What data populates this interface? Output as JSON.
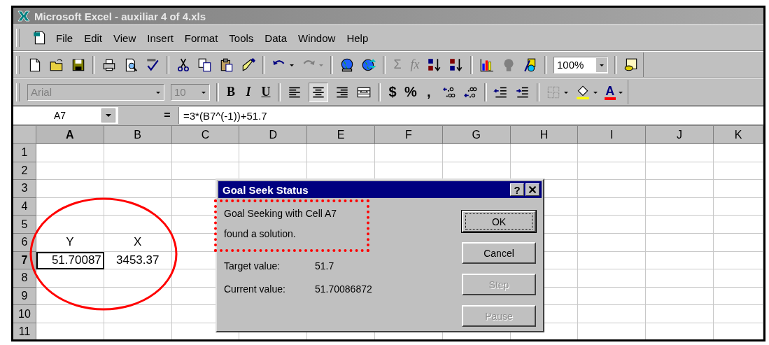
{
  "window": {
    "title": "Microsoft Excel - auxiliar 4 of 4.xls"
  },
  "menu": [
    "File",
    "Edit",
    "View",
    "Insert",
    "Format",
    "Tools",
    "Data",
    "Window",
    "Help"
  ],
  "standard_toolbar": {
    "sum": "Σ",
    "function": "fx",
    "zoom": "100%"
  },
  "formatting_toolbar": {
    "font": "Arial",
    "size": "10",
    "bold": "B",
    "italic": "I",
    "underline": "U",
    "currency": "$",
    "percent": "%",
    "comma": ",",
    "font_color": "A"
  },
  "formula_bar": {
    "name_box": "A7",
    "equals": "=",
    "formula": "=3*(B7^(-1))+51.7"
  },
  "sheet": {
    "columns": [
      {
        "label": "A",
        "selected": true
      },
      {
        "label": "B",
        "selected": false
      },
      {
        "label": "C",
        "selected": false
      },
      {
        "label": "D",
        "selected": false
      },
      {
        "label": "E",
        "selected": false
      },
      {
        "label": "F",
        "selected": false
      },
      {
        "label": "G",
        "selected": false
      },
      {
        "label": "H",
        "selected": false
      },
      {
        "label": "I",
        "selected": false
      },
      {
        "label": "J",
        "selected": false
      },
      {
        "label": "K",
        "selected": false
      }
    ],
    "rows": [
      {
        "label": "1",
        "selected": false
      },
      {
        "label": "2",
        "selected": false
      },
      {
        "label": "3",
        "selected": false
      },
      {
        "label": "4",
        "selected": false
      },
      {
        "label": "5",
        "selected": false
      },
      {
        "label": "6",
        "selected": false,
        "cells": [
          {
            "value": "Y",
            "selected": false
          },
          {
            "value": "X",
            "selected": false
          }
        ]
      },
      {
        "label": "7",
        "selected": true,
        "cells": [
          {
            "value": "51.70087",
            "selected": true
          },
          {
            "value": "3453.37",
            "selected": false
          }
        ]
      },
      {
        "label": "8",
        "selected": false
      },
      {
        "label": "9",
        "selected": false
      },
      {
        "label": "10",
        "selected": false
      },
      {
        "label": "11",
        "selected": false
      }
    ]
  },
  "dialog": {
    "title": "Goal Seek Status",
    "help": "?",
    "message_lines": [
      "Goal Seeking with Cell A7",
      "found a solution."
    ],
    "fields": [
      {
        "label": "Target value:",
        "value": "51.7"
      },
      {
        "label": "Current value:",
        "value": "51.70086872"
      }
    ],
    "buttons": [
      {
        "label": "OK",
        "disabled": false,
        "default": true
      },
      {
        "label": "Cancel",
        "disabled": false,
        "default": false
      },
      {
        "label": "Step",
        "disabled": true,
        "default": false
      },
      {
        "label": "Pause",
        "disabled": true,
        "default": false
      }
    ]
  }
}
